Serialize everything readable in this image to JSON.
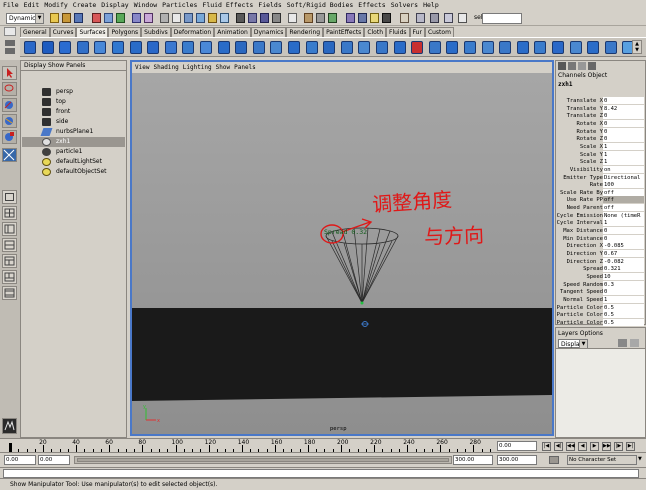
{
  "menubar": [
    "File",
    "Edit",
    "Modify",
    "Create",
    "Display",
    "Window",
    "Particles",
    "Fluid Effects",
    "Fields",
    "Soft/Rigid Bodies",
    "Effects",
    "Solvers",
    "Help"
  ],
  "toolbar": {
    "mode_dropdown": "Dynamics",
    "sel_label": "sel"
  },
  "shelf_tabs": [
    "General",
    "Curves",
    "Surfaces",
    "Polygons",
    "Subdivs",
    "Deformation",
    "Animation",
    "Dynamics",
    "Rendering",
    "PaintEffects",
    "Cloth",
    "Fluids",
    "Fur",
    "Custom"
  ],
  "active_tab": "Surfaces",
  "outliner": {
    "menu": "Display  Show  Panels",
    "items": [
      {
        "label": "persp",
        "icon": "camera-icon"
      },
      {
        "label": "top",
        "icon": "camera-icon"
      },
      {
        "label": "front",
        "icon": "camera-icon"
      },
      {
        "label": "side",
        "icon": "camera-icon"
      },
      {
        "label": "nurbsPlane1",
        "icon": "nurbs-plane-icon"
      },
      {
        "label": "zxh1",
        "icon": "emitter-icon",
        "selected": true
      },
      {
        "label": "particle1",
        "icon": "particle-icon"
      },
      {
        "label": "defaultLightSet",
        "icon": "set-icon"
      },
      {
        "label": "defaultObjectSet",
        "icon": "set-icon"
      }
    ]
  },
  "viewport": {
    "menu": [
      "View",
      "Shading",
      "Lighting",
      "Show",
      "Panels"
    ],
    "camera_label": "persp",
    "object_label": "Spread 0.32",
    "annotation_line1": "调整角度",
    "annotation_line2": "与方向",
    "axis_x": "x",
    "axis_y": "y"
  },
  "channel_box": {
    "tabs": "Channels  Object",
    "object": "zxh1",
    "rows": [
      {
        "label": "Translate X",
        "value": "0"
      },
      {
        "label": "Translate Y",
        "value": "8.42"
      },
      {
        "label": "Translate Z",
        "value": "0"
      },
      {
        "label": "Rotate X",
        "value": "0"
      },
      {
        "label": "Rotate Y",
        "value": "0"
      },
      {
        "label": "Rotate Z",
        "value": "0"
      },
      {
        "label": "Scale X",
        "value": "1"
      },
      {
        "label": "Scale Y",
        "value": "1"
      },
      {
        "label": "Scale Z",
        "value": "1"
      },
      {
        "label": "Visibility",
        "value": "on"
      },
      {
        "label": "Emitter Type",
        "value": "Directional"
      },
      {
        "label": "Rate",
        "value": "100"
      },
      {
        "label": "Scale Rate By",
        "value": "off"
      },
      {
        "label": "Use Rate PP",
        "value": "off",
        "hi": true
      },
      {
        "label": "Need Parent",
        "value": "off"
      },
      {
        "label": "Cycle Emission",
        "value": "None (timeR"
      },
      {
        "label": "Cycle Interval",
        "value": "1"
      },
      {
        "label": "Max Distance",
        "value": "0"
      },
      {
        "label": "Min Distance",
        "value": "0"
      },
      {
        "label": "Direction X",
        "value": "-0.085"
      },
      {
        "label": "Direction Y",
        "value": "0.67"
      },
      {
        "label": "Direction Z",
        "value": "-0.082"
      },
      {
        "label": "Spread",
        "value": "0.321"
      },
      {
        "label": "Speed",
        "value": "10"
      },
      {
        "label": "Speed Random",
        "value": "0.3"
      },
      {
        "label": "Tangent Speed",
        "value": "0"
      },
      {
        "label": "Normal Speed",
        "value": "1"
      },
      {
        "label": "Particle Color",
        "value": "0.5"
      },
      {
        "label": "Particle Color",
        "value": "0.5"
      },
      {
        "label": "Particle Color",
        "value": "0.5"
      }
    ]
  },
  "layers": {
    "title": "Layers  Options",
    "dropdown": "Display"
  },
  "timeline": {
    "ticks": [
      "20",
      "40",
      "60",
      "80",
      "100",
      "120",
      "140",
      "160",
      "180",
      "200",
      "220",
      "240",
      "260",
      "280"
    ],
    "current": "0.00"
  },
  "range": {
    "start": "0.00",
    "inner_start": "0.00",
    "inner_end": "300.00",
    "end": "300.00",
    "character": "No Character Set"
  },
  "help_line": "Show Manipulator Tool: Use manipulator(s) to edit selected object(s)."
}
